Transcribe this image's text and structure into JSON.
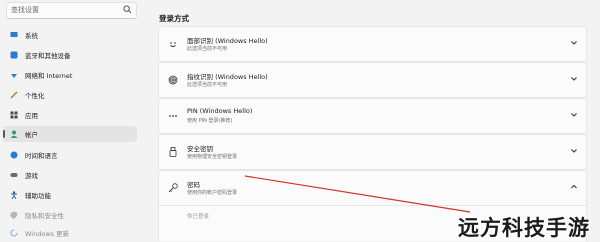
{
  "search": {
    "placeholder": "查找设置"
  },
  "sidebar": {
    "items": [
      {
        "label": "系统",
        "icon": "monitor-icon"
      },
      {
        "label": "蓝牙和其他设备",
        "icon": "bluetooth-icon"
      },
      {
        "label": "网络和 Internet",
        "icon": "wifi-icon"
      },
      {
        "label": "个性化",
        "icon": "brush-icon"
      },
      {
        "label": "应用",
        "icon": "apps-icon"
      },
      {
        "label": "帐户",
        "icon": "account-icon",
        "selected": true
      },
      {
        "label": "时间和语言",
        "icon": "globe-icon"
      },
      {
        "label": "游戏",
        "icon": "gamepad-icon"
      },
      {
        "label": "辅助功能",
        "icon": "accessibility-icon"
      },
      {
        "label": "隐私和安全性",
        "icon": "shield-icon"
      },
      {
        "label": "Windows 更新",
        "icon": "update-icon"
      }
    ]
  },
  "main": {
    "section_title": "登录方式",
    "options": [
      {
        "title": "面部识别 (Windows Hello)",
        "subtitle": "此选项当前不可用",
        "icon": "face-icon",
        "expanded": false
      },
      {
        "title": "指纹识别 (Windows Hello)",
        "subtitle": "此选项当前不可用",
        "icon": "fingerprint-icon",
        "expanded": false
      },
      {
        "title": "PIN (Windows Hello)",
        "subtitle": "使用 PIN 登录(推荐)",
        "icon": "pin-icon",
        "expanded": false
      },
      {
        "title": "安全密钥",
        "subtitle": "使用物理安全密钥登录",
        "icon": "usb-key-icon",
        "expanded": false
      },
      {
        "title": "密码",
        "subtitle": "使用你的帐户密码登录",
        "icon": "key-icon",
        "expanded": true
      }
    ],
    "password_detail": "你已登录"
  },
  "colors": {
    "annotation_line": "#d2342a",
    "selected_bg": "#e4e4e4",
    "card_bg": "#fbfbfb"
  },
  "watermark": "远方科技手游"
}
